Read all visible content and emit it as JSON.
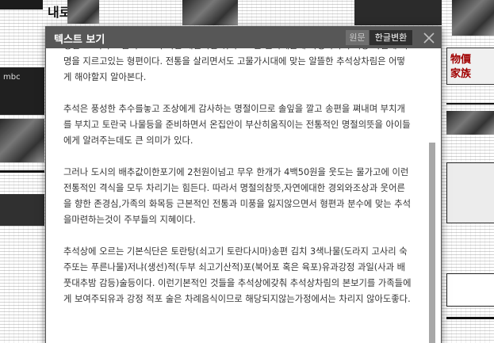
{
  "modal": {
    "title": "텍스트 보기",
    "btn_original": "원문",
    "btn_translate": "한글변환",
    "close_icon": "close-icon"
  },
  "article": {
    "paragraphs": [
      "명절. 그러나 고물적으로 주석밑 제밀미면 뛰어오르는 물가때문에 가정마다 추석상 마련에 비명을 지르고있는 형편이다. 전통을 살리면서도 고물가시대에 맞는 알뜰한 추석상차림은 어떻게 해야할지 알아본다.",
      "추석은 풍성한 추수를놓고 조상에게 감사하는 명절이므로 솔잎을 깔고 송편을 쪄내며 부치개를 부치고 토란국 나물등을 준비하면서 온집안이 부산히움직이는 전통적인 명절의뜻을 아이들에게 알려주는데도 큰 의미가 있다.",
      "그러나 도시의 배추값이한포기에 2천원이넘고 무우 한개가 4백50원을 웃도는 물가고에 이런 전통적인 격식을 모두 차리기는 힘든다. 따라서 명절의참뜻,자연에대한 경외와조상과 웃어른을 향한 존경심,가족의 화목등 근본적인 전통과 미풍을 잃지않으면서 형편과 분수에 맞는 추석을마련하는것이 주부들의 지혜이다.",
      "추석상에 오르는 기본식단은 토란탕(쇠고기 토란다시마)송편 김치 3색나물(도라지 고사리 숙주또는 푸른나물)저냐(생선)적(두부 쇠고기산적)포(북어포 혹은 육포)유과강정 과일(사과 배 풋대추밤 감등)술등이다. 이런기본적인 것들을 추석상에갖춰 추석상차림의 본보기를 가족들에게 보여주되유과 강정 적포 술은 차례음식이므로 해당되지않는가정에서는 차리지 않아도좋다."
    ]
  },
  "background": {
    "headlines": [
      "내로",
      "物價",
      "家族"
    ],
    "logo_text": "mbc"
  },
  "colors": {
    "header_bg": "#575757",
    "btn_active_bg": "#2f2f2f",
    "btn_inactive_bg": "#6e6e6e",
    "text": "#333333",
    "scroll_thumb": "#a8a8a8"
  }
}
